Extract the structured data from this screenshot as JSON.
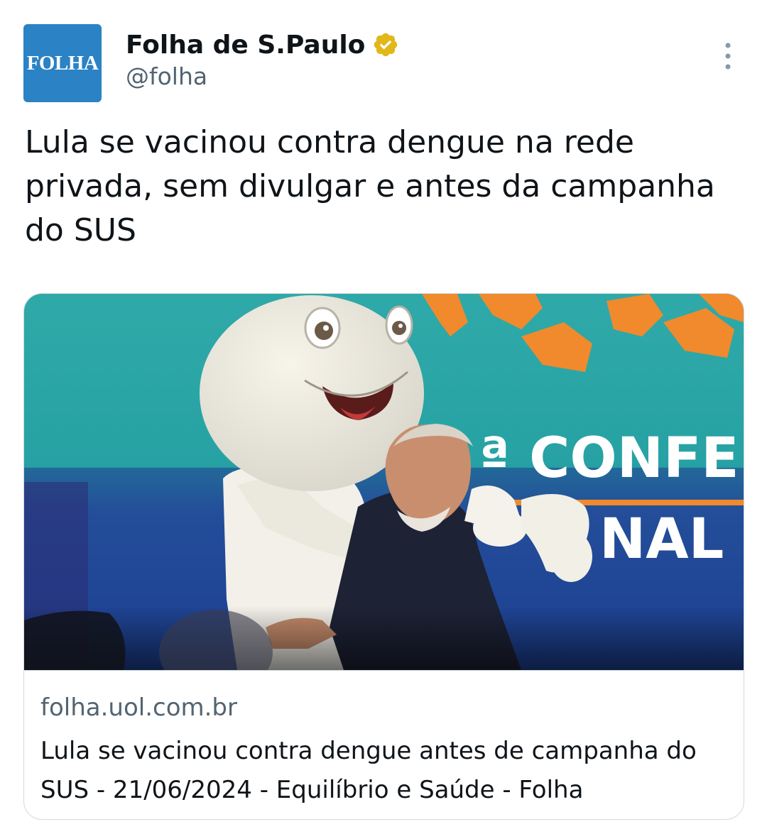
{
  "author": {
    "avatar_text": "FOLHA",
    "display_name": "Folha de S.Paulo",
    "handle": "@folha",
    "verified": true,
    "brand_color": "#2b82c4",
    "verified_color": "#e2b719"
  },
  "tweet": {
    "text": "Lula se vacinou contra dengue na rede privada, sem divulgar e antes da campanha do SUS"
  },
  "link_card": {
    "domain": "folha.uol.com.br",
    "title": "Lula se vacinou contra dengue antes de campanha do SUS - 21/06/2024 - Equilíbrio e Saúde - Folha",
    "image_text": {
      "line1": "ª CONFE",
      "line2": "NAL D"
    }
  },
  "icons": {
    "more": "more-vertical-icon",
    "verified": "verified-badge-icon"
  }
}
